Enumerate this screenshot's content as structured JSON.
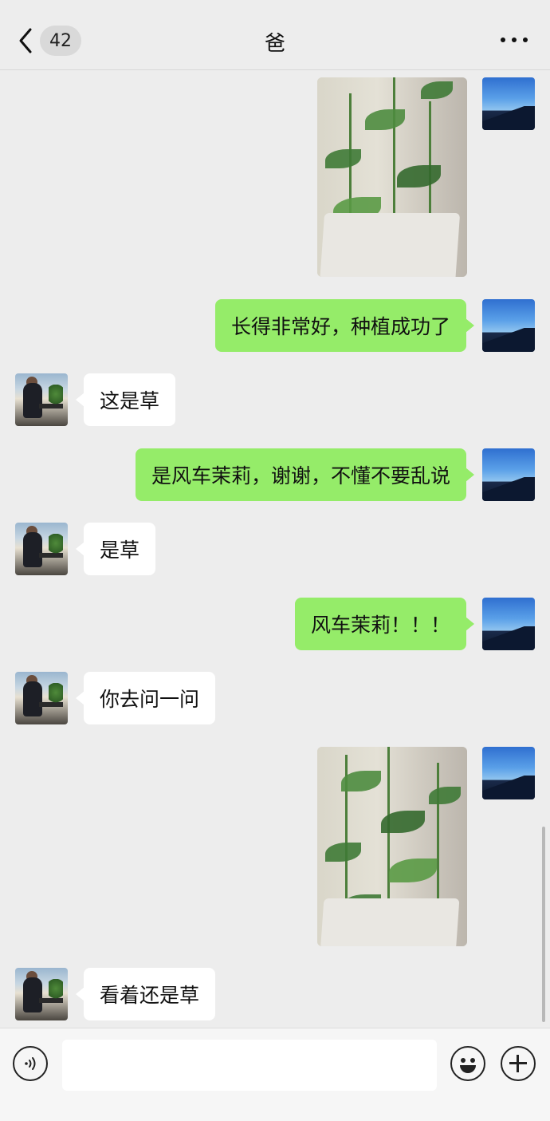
{
  "header": {
    "unread_count": "42",
    "title": "爸"
  },
  "messages": [
    {
      "sender": "me",
      "type": "image",
      "description_icon": "plant-photo"
    },
    {
      "sender": "me",
      "type": "text",
      "text": "长得非常好，种植成功了"
    },
    {
      "sender": "dad",
      "type": "text",
      "text": "这是草"
    },
    {
      "sender": "me",
      "type": "text",
      "text": "是风车茉莉，谢谢，不懂不要乱说"
    },
    {
      "sender": "dad",
      "type": "text",
      "text": "是草"
    },
    {
      "sender": "me",
      "type": "text",
      "text": "风车茉莉！！！"
    },
    {
      "sender": "dad",
      "type": "text",
      "text": "你去问一问"
    },
    {
      "sender": "me",
      "type": "image",
      "description_icon": "plant-photo"
    },
    {
      "sender": "dad",
      "type": "text",
      "text": "看着还是草"
    }
  ],
  "composer": {
    "input_value": ""
  },
  "colors": {
    "background": "#ededed",
    "my_bubble": "#95ec69",
    "their_bubble": "#ffffff"
  }
}
